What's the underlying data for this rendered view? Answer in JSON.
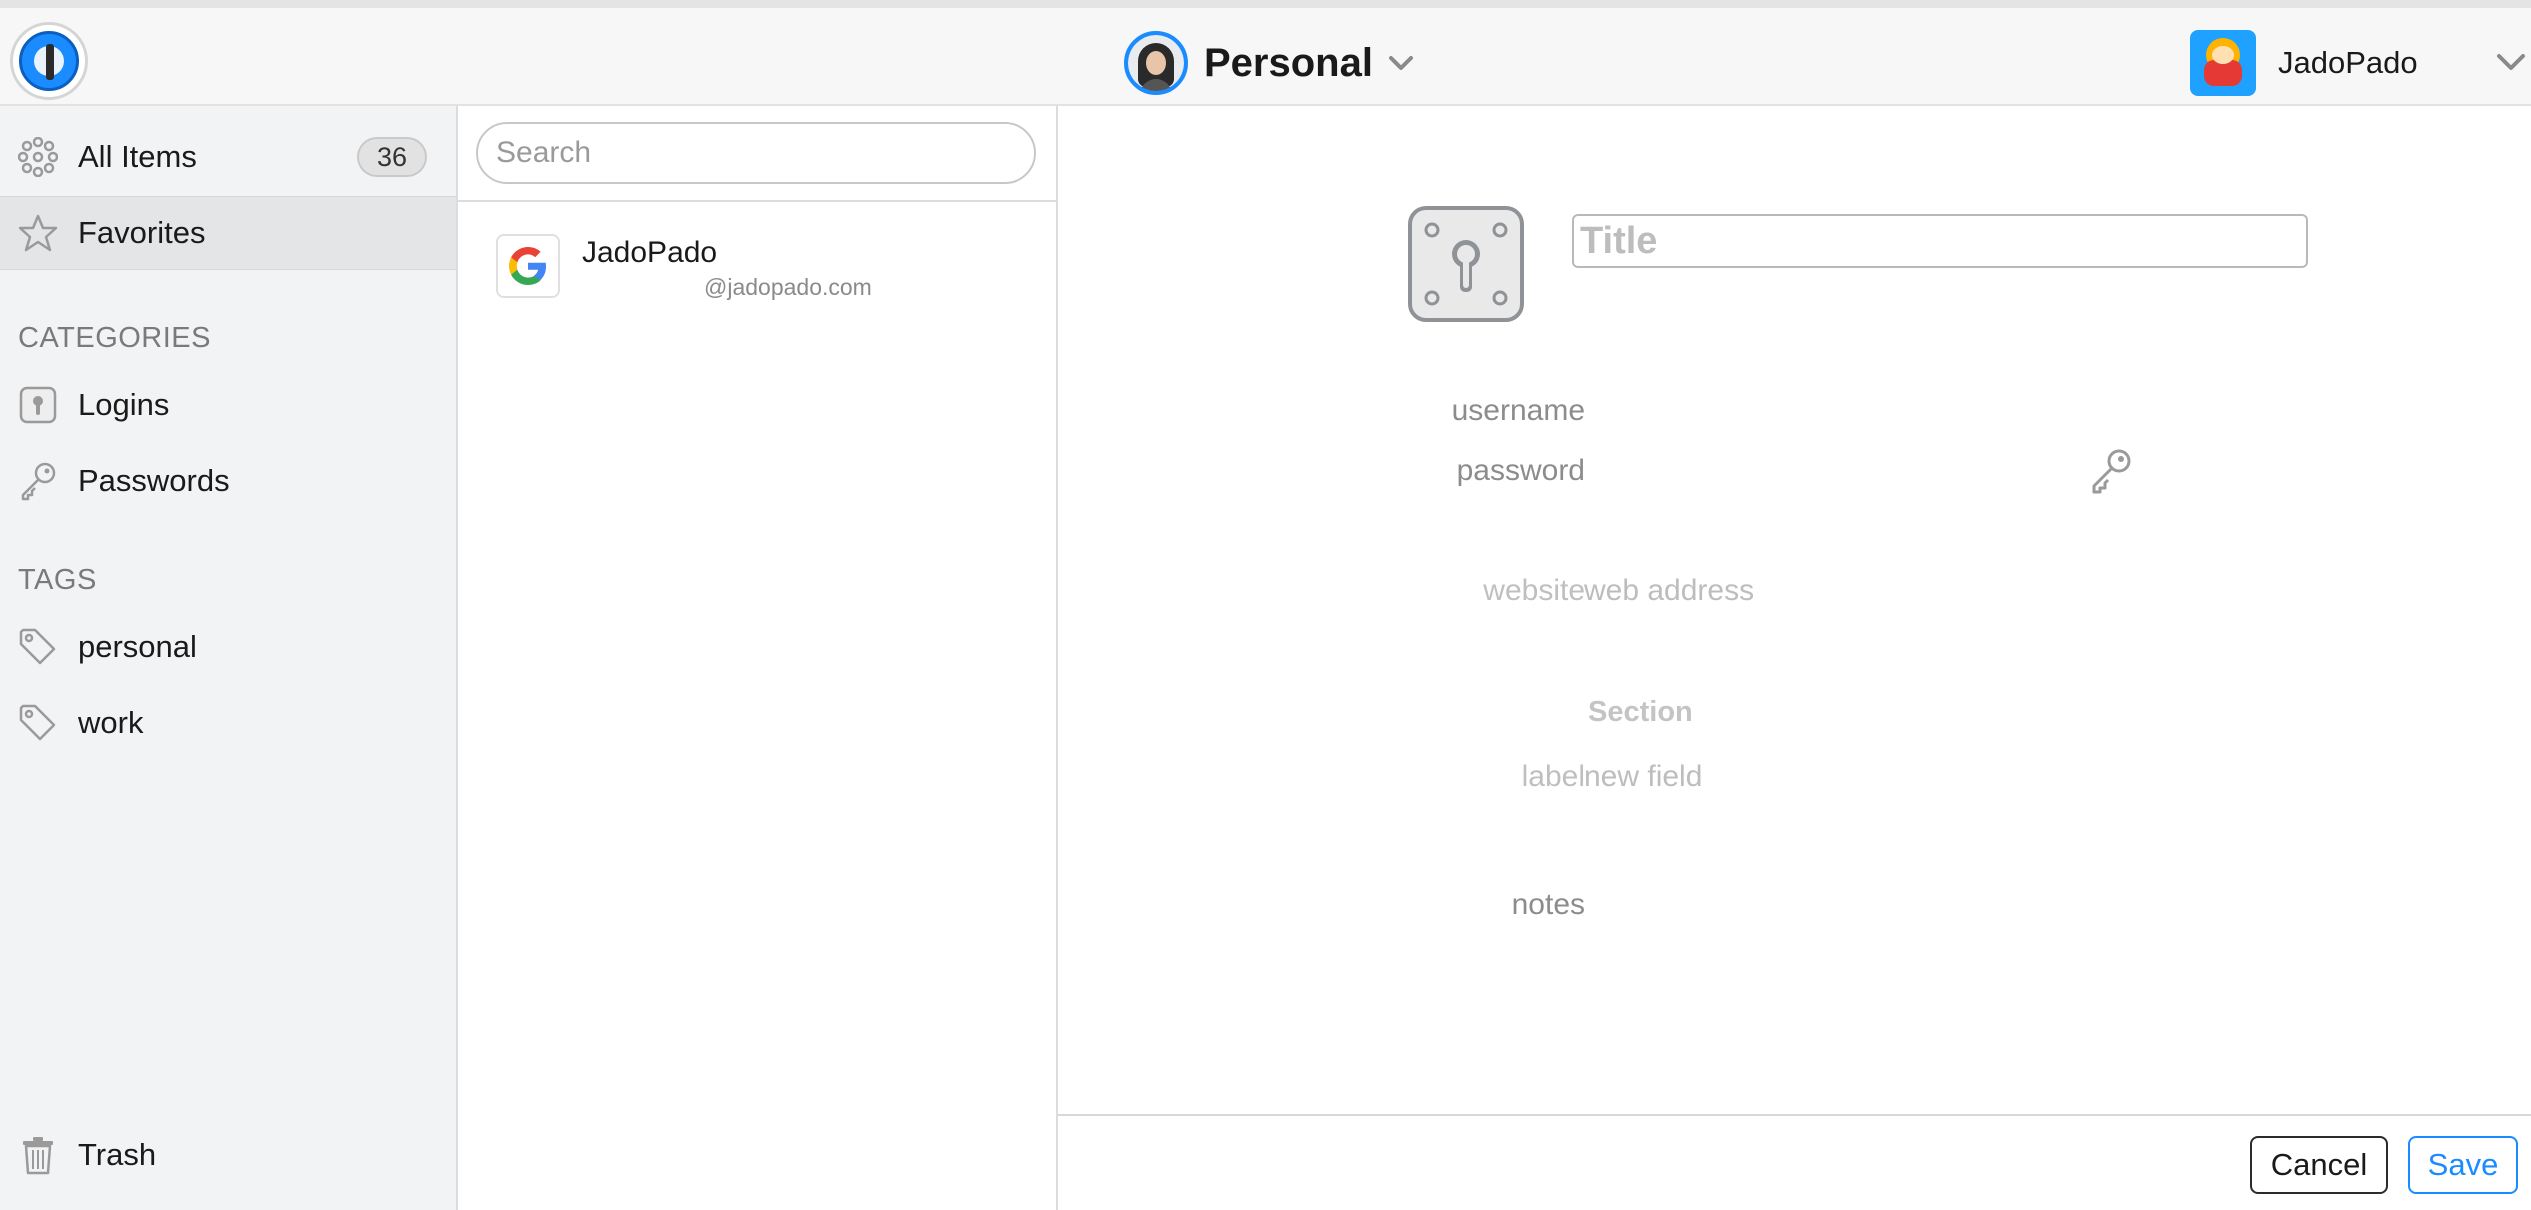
{
  "header": {
    "vault_name": "Personal",
    "account_name": "JadoPado"
  },
  "sidebar": {
    "all_items": {
      "label": "All Items",
      "count": "36"
    },
    "favorites": {
      "label": "Favorites"
    },
    "categories_heading": "CATEGORIES",
    "categories": [
      {
        "label": "Logins",
        "icon": "login-keyhole-icon"
      },
      {
        "label": "Passwords",
        "icon": "key-icon"
      }
    ],
    "tags_heading": "TAGS",
    "tags": [
      {
        "label": "personal",
        "icon": "tag-icon"
      },
      {
        "label": "work",
        "icon": "tag-icon"
      }
    ],
    "trash": {
      "label": "Trash"
    }
  },
  "list": {
    "search_placeholder": "Search",
    "items": [
      {
        "title": "JadoPado",
        "subtitle": "@jadopado.com",
        "icon": "google-icon"
      }
    ]
  },
  "detail": {
    "title_placeholder": "Title",
    "fields": {
      "username_label": "username",
      "password_label": "password",
      "website_label": "website",
      "website_placeholder": "web address",
      "section_title": "Section",
      "custom_label": "label",
      "custom_placeholder": "new field",
      "notes_label": "notes"
    }
  },
  "footer": {
    "cancel_label": "Cancel",
    "save_label": "Save"
  },
  "colors": {
    "accent": "#1a8cff",
    "sidebar_bg": "#f2f3f4",
    "selected_bg": "#e4e5e7"
  }
}
